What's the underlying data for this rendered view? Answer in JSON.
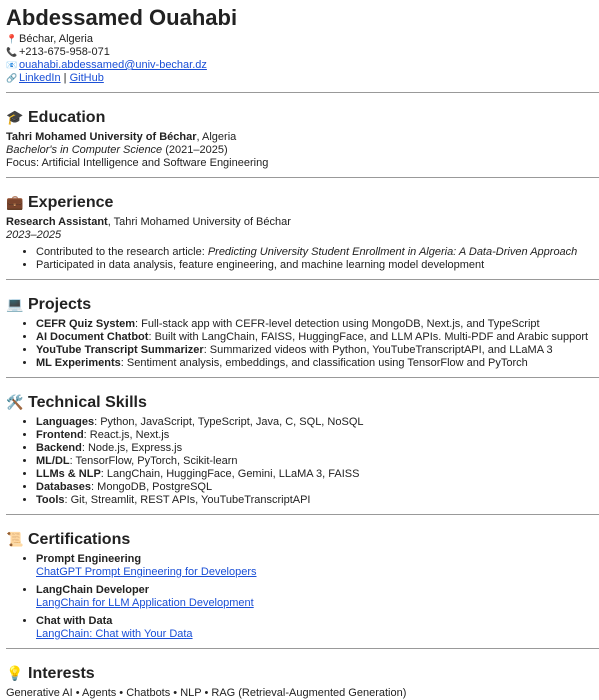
{
  "header": {
    "name": "Abdessamed Ouahabi",
    "location_icon": "pin-icon",
    "location": "Béchar, Algeria",
    "phone_icon": "phone-icon",
    "phone": "+213-675-958-071",
    "email_icon": "email-icon",
    "email": "ouahabi.abdessamed@univ-bechar.dz",
    "links_icon": "link-icon",
    "linkedin": "LinkedIn",
    "separator": "|",
    "github": "GitHub"
  },
  "education": {
    "icon": "graduation-cap-icon",
    "title": "Education",
    "school": "Tahri Mohamed University of Béchar",
    "school_suffix": ", Algeria",
    "degree": "Bachelor's in Computer Science",
    "years": " (2021–2025)",
    "focus": "Focus: Artificial Intelligence and Software Engineering"
  },
  "experience": {
    "icon": "briefcase-icon",
    "title": "Experience",
    "role": "Research Assistant",
    "org": ", Tahri Mohamed University of Béchar",
    "dates": "2023–2025",
    "bullets": [
      {
        "text": "Contributed to the research article: ",
        "em": "Predicting University Student Enrollment in Algeria: A Data-Driven Approach"
      },
      {
        "text": "Participated in data analysis, feature engineering, and machine learning model development",
        "em": ""
      }
    ]
  },
  "projects": {
    "icon": "laptop-icon",
    "title": "Projects",
    "items": [
      {
        "name": "CEFR Quiz System",
        "desc": ": Full-stack app with CEFR-level detection using MongoDB, Next.js, and TypeScript"
      },
      {
        "name": "AI Document Chatbot",
        "desc": ": Built with LangChain, FAISS, HuggingFace, and LLM APIs. Multi-PDF and Arabic support"
      },
      {
        "name": "YouTube Transcript Summarizer",
        "desc": ": Summarized videos with Python, YouTubeTranscriptAPI, and LLaMA 3"
      },
      {
        "name": "ML Experiments",
        "desc": ": Sentiment analysis, embeddings, and classification using TensorFlow and PyTorch"
      }
    ]
  },
  "skills": {
    "icon": "tools-icon",
    "title": "Technical Skills",
    "items": [
      {
        "name": "Languages",
        "desc": ": Python, JavaScript, TypeScript, Java, C, SQL, NoSQL"
      },
      {
        "name": "Frontend",
        "desc": ": React.js, Next.js"
      },
      {
        "name": "Backend",
        "desc": ": Node.js, Express.js"
      },
      {
        "name": "ML/DL",
        "desc": ": TensorFlow, PyTorch, Scikit-learn"
      },
      {
        "name": "LLMs & NLP",
        "desc": ": LangChain, HuggingFace, Gemini, LLaMA 3, FAISS"
      },
      {
        "name": "Databases",
        "desc": ": MongoDB, PostgreSQL"
      },
      {
        "name": "Tools",
        "desc": ": Git, Streamlit, REST APIs, YouTubeTranscriptAPI"
      }
    ]
  },
  "certifications": {
    "icon": "scroll-icon",
    "title": "Certifications",
    "items": [
      {
        "name": "Prompt Engineering",
        "link": "ChatGPT Prompt Engineering for Developers"
      },
      {
        "name": "LangChain Developer",
        "link": "LangChain for LLM Application Development"
      },
      {
        "name": "Chat with Data",
        "link": "LangChain: Chat with Your Data"
      }
    ]
  },
  "interests": {
    "icon": "lightbulb-icon",
    "title": "Interests",
    "text": "Generative AI • Agents • Chatbots • NLP • RAG (Retrieval-Augmented Generation)"
  }
}
